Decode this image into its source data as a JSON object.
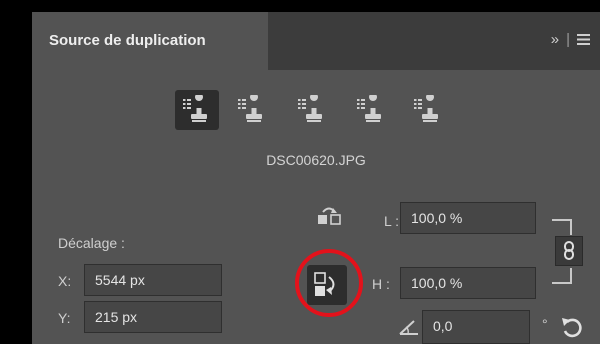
{
  "panel": {
    "title": "Source de duplication",
    "menu_chevron": "»",
    "menu_separator": "|",
    "menu_icon": "hamburger-menu-icon"
  },
  "sources": {
    "active_index": 0,
    "icons": [
      "clone-source-1-icon",
      "clone-source-2-icon",
      "clone-source-3-icon",
      "clone-source-4-icon",
      "clone-source-5-icon"
    ]
  },
  "file": {
    "name": "DSC00620.JPG"
  },
  "offset": {
    "label": "Décalage :",
    "x_label": "X:",
    "x_value": "5544 px",
    "y_label": "Y:",
    "y_value": "215 px"
  },
  "scale": {
    "w_label": "L :",
    "w_value": "100,0 %",
    "h_label": "H :",
    "h_value": "100,0 %"
  },
  "rotation": {
    "value": "0,0",
    "unit": "°"
  },
  "colors": {
    "panel_bg": "#535353",
    "field_bg": "#464646",
    "highlight_circle": "#e3121b"
  }
}
